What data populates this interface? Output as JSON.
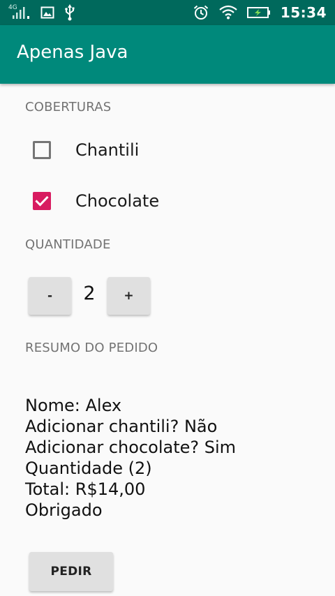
{
  "status_bar": {
    "network_type": "4G",
    "time": "15:34",
    "icons": [
      "signal-icon",
      "image-notification-icon",
      "usb-icon",
      "alarm-icon",
      "wifi-icon",
      "battery-charging-icon"
    ]
  },
  "app_bar": {
    "title": "Apenas Java",
    "background_color": "#00897b",
    "status_color": "#00695c"
  },
  "toppings": {
    "header": "COBERTURAS",
    "items": [
      {
        "label": "Chantili",
        "checked": false
      },
      {
        "label": "Chocolate",
        "checked": true
      }
    ],
    "accent_color": "#d81b60"
  },
  "quantity": {
    "header": "QUANTIDADE",
    "decrement_label": "-",
    "value": "2",
    "increment_label": "+"
  },
  "summary": {
    "header": "RESUMO DO PEDIDO",
    "lines": [
      "Nome: Alex",
      "Adicionar chantili? Não",
      "Adicionar chocolate? Sim",
      "Quantidade (2)",
      "Total: R$14,00",
      "Obrigado"
    ]
  },
  "order_button": {
    "label": "PEDIR"
  }
}
